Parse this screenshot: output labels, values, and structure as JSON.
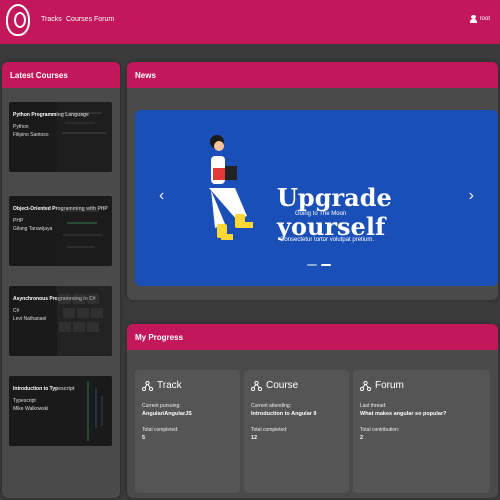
{
  "nav": {
    "links": [
      "Tracks",
      "Courses",
      "Forum"
    ],
    "user_label": "root"
  },
  "latest_courses": {
    "title": "Latest Courses",
    "items": [
      {
        "title": "Python Programming Language",
        "language": "Python",
        "author": "Filipino Santoso"
      },
      {
        "title": "Object-Oriented Programming with PHP",
        "language": "PHP",
        "author": "Gilang Taruwijaya"
      },
      {
        "title": "Asynchronous Programming in C#",
        "language": "C#",
        "author": "Levi Nathanael"
      },
      {
        "title": "Introduction to Typescript",
        "language": "Typescript",
        "author": "Mike Walkowski"
      }
    ]
  },
  "news": {
    "title": "News",
    "slide": {
      "headline": "Upgrade yourself",
      "line1": "Going to The Moon",
      "line2": "Consectetur tortor volutpat pretium."
    },
    "prev_icon": "chevron-left-icon",
    "next_icon": "chevron-right-icon",
    "slide_count": 2,
    "active_slide": 2
  },
  "progress": {
    "title": "My Progress",
    "cards": [
      {
        "title": "Track",
        "label1": "Current pursuing:",
        "value1": "Angular/AngularJS",
        "label2": "Total completed:",
        "value2": "5"
      },
      {
        "title": "Course",
        "label1": "Current attending:",
        "value1": "Introduction to Angular 9",
        "label2": "Total completed:",
        "value2": "12"
      },
      {
        "title": "Forum",
        "label1": "Last thread:",
        "value1": "What makes angular so popular?",
        "label2": "Total contribution:",
        "value2": "2"
      }
    ]
  },
  "colors": {
    "brand": "#c2185b",
    "slide_bg": "#1b4fb8",
    "page_bg": "#3b3b3b"
  }
}
